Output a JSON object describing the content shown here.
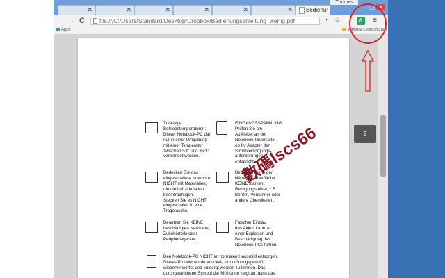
{
  "browser": {
    "tabs_inactive": [
      "",
      "",
      "",
      "",
      "",
      ""
    ],
    "active_tab_label": "Bedienur",
    "user_label": "Thomas",
    "window_controls": [
      "_",
      "▢",
      "✕"
    ],
    "address": "file:///C:/Users/Standard/Desktop/Dropbox/Bedienungsanleitung_wenig.pdf",
    "bookmarks": {
      "apps": "Apps",
      "other": "Weitere Lesezeichen"
    }
  },
  "viewer": {
    "page_indicator": "2"
  },
  "pdf": {
    "block1": [
      "Zulässige",
      "Betriebstemperaturen:",
      "Dieser Notebook-PC darf",
      "nur in einer Umgebung",
      "mit einer Temperatur",
      "zwischen 5°C und 35°C",
      "verwendet werden."
    ],
    "block2": [
      "EINGANGSSPANNUNG:",
      "Prüfen Sie am",
      "Aufkleber an der",
      "Notebook-Unterseite,",
      "ob Ihr Adapter den",
      "Stromversorgungs-",
      "anforderungen",
      "entspricht."
    ],
    "block3": [
      "Bedecken Sie das",
      "eingeschaltete Notebook",
      "NICHT mit Materialien,",
      "die die Luftzirkulation",
      "beeinträchtigen.",
      "Stecken Sie es NICHT",
      "eingeschaltet in eine",
      "Tragetasche."
    ],
    "block4": [
      "Benutzen Sie in der",
      "Nähe der Oberfläche",
      "KEINE starken",
      "Reinigungsmittel, z.B.",
      "Benzin, Verdünner oder",
      "andere Chemikalien."
    ],
    "block5": [
      "Benutzen Sie KEINE",
      "beschädigten Netzkabel,",
      "Zubehörteile oder",
      "Peripheriegeräte."
    ],
    "block6": [
      "Falscher Einbau",
      "des Akkus kann zu",
      "einer Explosion und",
      "Beschädigung des",
      "Notebook-PCs führen."
    ],
    "block7": [
      "Den Notebook-PC NICHT im normalen Hausmüll entsorgen.",
      "Dieses Produkt wurde entickelt, um ordnungsgemäß",
      "wiederverwertet und entsorgt werden zu können. Das",
      "durchgestrichene Symbol der Mülltonne zeigt an, dass das"
    ],
    "watermark": "數碼lscs66"
  }
}
